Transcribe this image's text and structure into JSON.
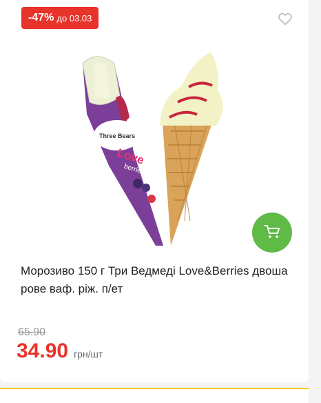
{
  "badge": {
    "discount": "-47%",
    "until": "до 03.03"
  },
  "icons": {
    "favorite": "heart-outline-icon",
    "cart": "cart-icon"
  },
  "product": {
    "title": "Морозиво 150 г Три Ведмеді Love&Berries двошарове ваф. ріж. п/ет",
    "packaging_text": {
      "brand": "Three Bears",
      "line1": "Love",
      "line2": "berries"
    }
  },
  "pricing": {
    "old_price": "65.90",
    "price": "34.90",
    "unit": "грн/шт"
  },
  "colors": {
    "accent": "#e8332a",
    "cart": "#5fbb46",
    "muted": "#999999"
  }
}
